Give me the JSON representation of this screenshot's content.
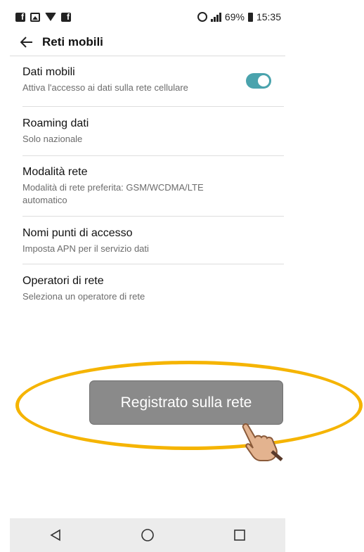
{
  "status_bar": {
    "battery_percent": "69%",
    "time": "15:35"
  },
  "header": {
    "title": "Reti mobili"
  },
  "settings": [
    {
      "title": "Dati mobili",
      "subtitle": "Attiva l'accesso ai dati sulla rete cellulare",
      "toggle_on": true
    },
    {
      "title": "Roaming dati",
      "subtitle": "Solo nazionale"
    },
    {
      "title": "Modalità rete",
      "subtitle": "Modalità di rete preferita: GSM/WCDMA/LTE automatico"
    },
    {
      "title": "Nomi punti di accesso",
      "subtitle": "Imposta APN per il servizio dati"
    },
    {
      "title": "Operatori di rete",
      "subtitle": "Seleziona un operatore di rete"
    }
  ],
  "toast": {
    "message": "Registrato sulla rete"
  },
  "colors": {
    "toggle_accent": "#4aa3ad",
    "highlight_ellipse": "#f5b400",
    "toast_bg": "#8a8a8a"
  },
  "icons": {
    "back": "arrow-left-icon",
    "nav_back": "triangle-back-icon",
    "nav_home": "circle-home-icon",
    "nav_recent": "square-recent-icon"
  }
}
